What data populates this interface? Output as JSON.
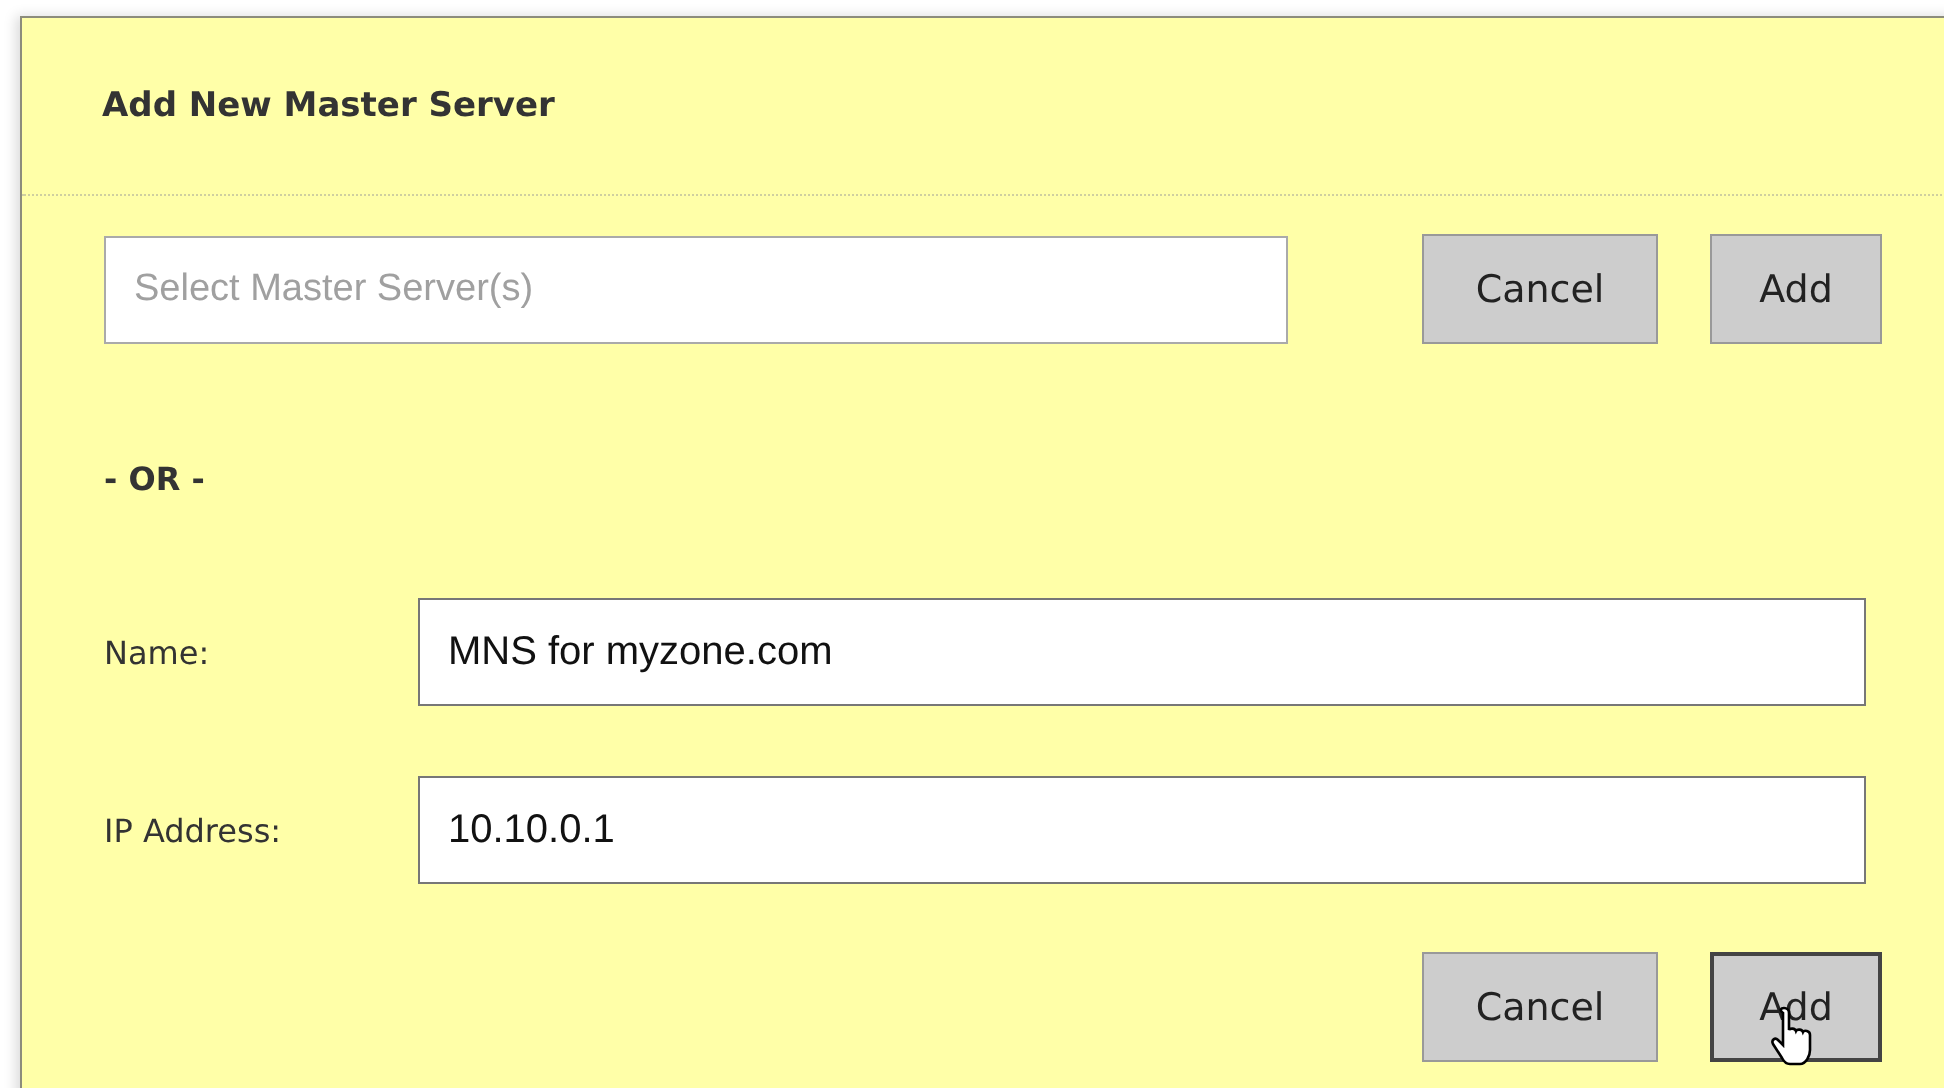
{
  "dialog": {
    "title": "Add New Master Server"
  },
  "select": {
    "placeholder": "Select Master Server(s)",
    "buttons": [
      {
        "label": "Cancel",
        "hovered": false
      },
      {
        "label": "Add",
        "hovered": false
      }
    ]
  },
  "separator": "- OR -",
  "fields": [
    {
      "label": "Name:",
      "value": "MNS for myzone.com"
    },
    {
      "label": "IP Address:",
      "value": "10.10.0.1"
    }
  ],
  "buttons": [
    {
      "label": "Cancel",
      "hovered": false
    },
    {
      "label": "Add",
      "hovered": true
    }
  ]
}
